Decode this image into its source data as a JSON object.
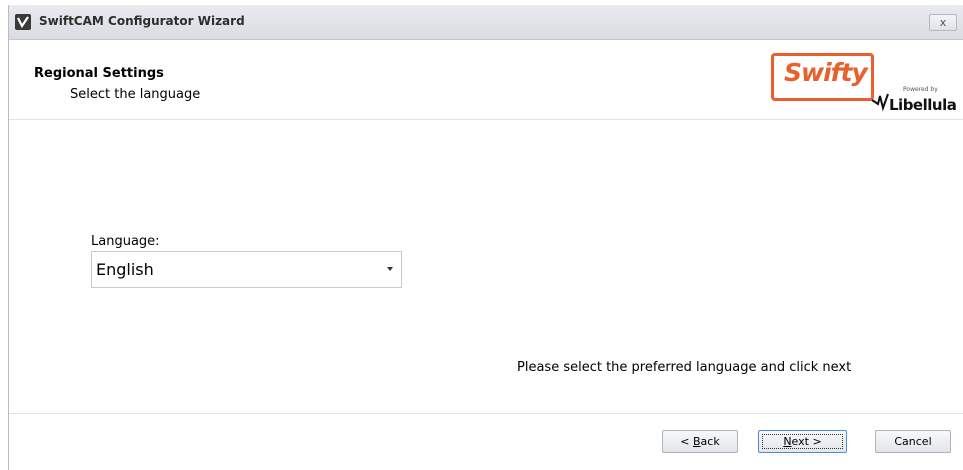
{
  "window": {
    "title": "SwiftCAM Configurator Wizard",
    "close_label": "x"
  },
  "header": {
    "title": "Regional Settings",
    "subtitle": "Select the language",
    "logo": {
      "brand": "Swifty",
      "powered_by": "Powered by",
      "vendor": "Libellula",
      "brand_color": "#e8602c"
    }
  },
  "form": {
    "language_label": "Language:",
    "language_selected": "English"
  },
  "hint": "Please select the preferred language and click next",
  "buttons": {
    "back_prefix": "< ",
    "back_mnemonic": "B",
    "back_rest": "ack",
    "next_mnemonic": "N",
    "next_rest": "ext >",
    "cancel": "Cancel"
  }
}
